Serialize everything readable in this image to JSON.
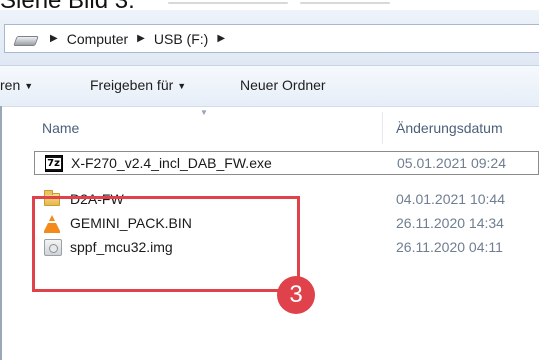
{
  "caption": "Siehe Bild 3:",
  "address": {
    "crumbs": [
      "Computer",
      "USB (F:)"
    ],
    "separator": "▶"
  },
  "toolbar": {
    "organize_label": "ren",
    "share_label": "Freigeben für",
    "new_folder_label": "Neuer Ordner",
    "caret": "▼"
  },
  "columns": {
    "name": "Name",
    "date": "Änderungsdatum",
    "sort_indicator": "▼"
  },
  "files": [
    {
      "name": "X-F270_v2.4_incl_DAB_FW.exe",
      "date": "05.01.2021 09:24",
      "icon": "7zip-archive-icon",
      "selected": true
    },
    {
      "name": "D2A-FW",
      "date": "04.01.2021 10:44",
      "icon": "folder-icon",
      "selected": false
    },
    {
      "name": "GEMINI_PACK.BIN",
      "date": "26.11.2020 14:34",
      "icon": "vlc-cone-icon",
      "selected": false
    },
    {
      "name": "sppf_mcu32.img",
      "date": "26.11.2020 04:11",
      "icon": "disk-image-icon",
      "selected": false
    }
  ],
  "annotation": {
    "number": "3",
    "color": "#e0424c"
  },
  "icon_labels": {
    "sevenzip": "7z"
  }
}
